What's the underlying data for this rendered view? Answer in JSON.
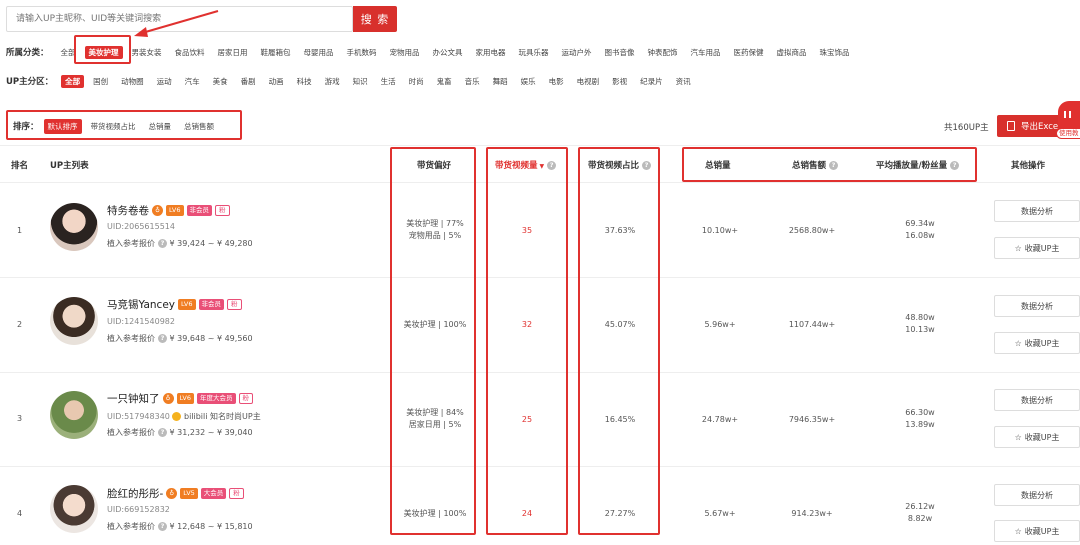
{
  "search": {
    "placeholder": "请输入UP主昵称、UID等关键词搜索",
    "button": "搜 索"
  },
  "category": {
    "label": "所属分类：",
    "items": [
      "全部",
      "美妆护理",
      "男装女装",
      "食品饮料",
      "居家日用",
      "鞋履箱包",
      "母婴用品",
      "手机数码",
      "宠物用品",
      "办公文具",
      "家用电器",
      "玩具乐器",
      "运动户外",
      "图书音像",
      "钟表配饰",
      "汽车用品",
      "医药保健",
      "虚拟商品",
      "珠宝饰品"
    ],
    "active_index": 1
  },
  "zone": {
    "label": "UP主分区：",
    "items": [
      "全部",
      "国创",
      "动物圈",
      "运动",
      "汽车",
      "美食",
      "番剧",
      "动画",
      "科技",
      "游戏",
      "知识",
      "生活",
      "时尚",
      "鬼畜",
      "音乐",
      "舞蹈",
      "娱乐",
      "电影",
      "电视剧",
      "影视",
      "纪录片",
      "资讯"
    ],
    "active_index": 0
  },
  "sort": {
    "label": "排序：",
    "items": [
      "默认排序",
      "带货视频占比",
      "总销量",
      "总销售额"
    ],
    "active_index": 0
  },
  "total": "共160UP主",
  "export_label": "导出Excel",
  "corner_label": "使用教",
  "columns": {
    "rank": "排名",
    "up_list": "UP主列表",
    "preference": "带货偏好",
    "video_count": "带货视频量",
    "video_ratio": "带货视频占比",
    "total_sales": "总销量",
    "total_revenue": "总销售额",
    "avg_play_ratio": "平均播放量/粉丝量",
    "ops": "其他操作"
  },
  "price_prefix": "植入参考报价",
  "buttons": {
    "analysis": "数据分析",
    "favorite": "收藏UP主"
  },
  "rows": [
    {
      "rank": "1",
      "name": "特务卷卷",
      "level": "LV6",
      "member": "非会员",
      "fan": "粉",
      "uid": "UID:2065615514",
      "cert": "",
      "price": "¥ 39,424 ~ ¥ 49,280",
      "pref1": "美妆护理 | 77%",
      "pref2": "宠物用品 | 5%",
      "video_count": "35",
      "video_ratio": "37.63%",
      "sales": "10.10w+",
      "revenue": "2568.80w+",
      "avg1": "69.34w",
      "avg2": "16.08w"
    },
    {
      "rank": "2",
      "name": "马竞锡Yancey",
      "level": "LV6",
      "member": "非会员",
      "fan": "粉",
      "uid": "UID:1241540982",
      "cert": "",
      "price": "¥ 39,648 ~ ¥ 49,560",
      "pref1": "美妆护理 | 100%",
      "pref2": "",
      "video_count": "32",
      "video_ratio": "45.07%",
      "sales": "5.96w+",
      "revenue": "1107.44w+",
      "avg1": "48.80w",
      "avg2": "10.13w"
    },
    {
      "rank": "3",
      "name": "一只钟知了",
      "level": "LV6",
      "member": "年度大会员",
      "fan": "粉",
      "uid": "UID:517948340",
      "cert": "bilibili 知名时尚UP主",
      "price": "¥ 31,232 ~ ¥ 39,040",
      "pref1": "美妆护理 | 84%",
      "pref2": "居家日用 | 5%",
      "video_count": "25",
      "video_ratio": "16.45%",
      "sales": "24.78w+",
      "revenue": "7946.35w+",
      "avg1": "66.30w",
      "avg2": "13.89w"
    },
    {
      "rank": "4",
      "name": "脸红的彤彤-",
      "level": "LV5",
      "member": "大会员",
      "fan": "粉",
      "uid": "UID:669152832",
      "cert": "",
      "price": "¥ 12,648 ~ ¥ 15,810",
      "pref1": "美妆护理 | 100%",
      "pref2": "",
      "video_count": "24",
      "video_ratio": "27.27%",
      "sales": "5.67w+",
      "revenue": "914.23w+",
      "avg1": "26.12w",
      "avg2": "8.82w"
    }
  ]
}
